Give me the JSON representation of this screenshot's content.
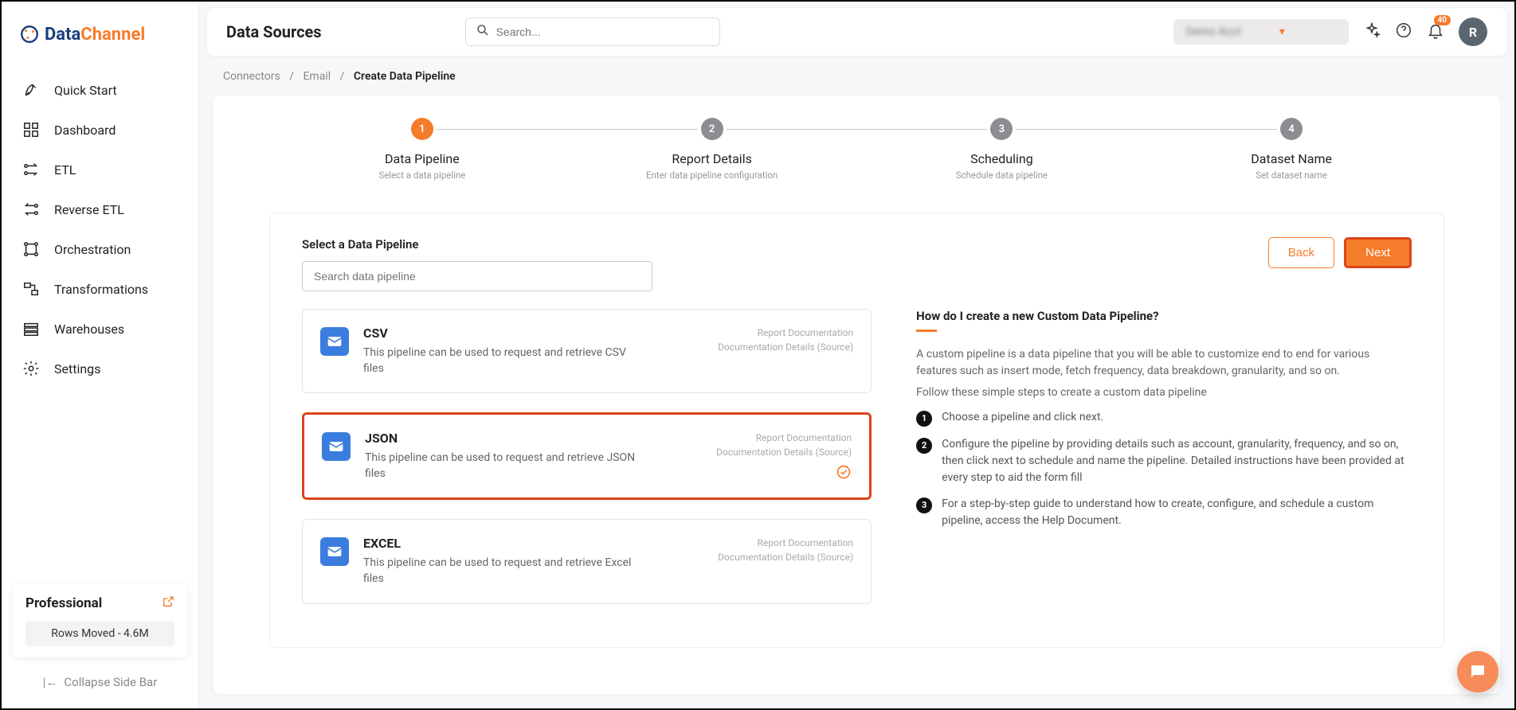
{
  "logo": {
    "text1": "Data",
    "text2": "Channel"
  },
  "sidebar": {
    "items": [
      {
        "label": "Quick Start"
      },
      {
        "label": "Dashboard"
      },
      {
        "label": "ETL"
      },
      {
        "label": "Reverse ETL"
      },
      {
        "label": "Orchestration"
      },
      {
        "label": "Transformations"
      },
      {
        "label": "Warehouses"
      },
      {
        "label": "Settings"
      }
    ],
    "plan": {
      "title": "Professional",
      "rows": "Rows Moved - 4.6M"
    },
    "collapse": "Collapse Side Bar"
  },
  "topbar": {
    "title": "Data Sources",
    "search_placeholder": "Search...",
    "account_label": "Demo Acct",
    "notif_count": "40",
    "avatar_letter": "R"
  },
  "breadcrumb": {
    "a": "Connectors",
    "b": "Email",
    "c": "Create Data Pipeline"
  },
  "stepper": [
    {
      "num": "1",
      "title": "Data Pipeline",
      "sub": "Select a data pipeline"
    },
    {
      "num": "2",
      "title": "Report Details",
      "sub": "Enter data pipeline configuration"
    },
    {
      "num": "3",
      "title": "Scheduling",
      "sub": "Schedule data pipeline"
    },
    {
      "num": "4",
      "title": "Dataset Name",
      "sub": "Set dataset name"
    }
  ],
  "inner": {
    "label": "Select a Data Pipeline",
    "search_placeholder": "Search data pipeline",
    "back": "Back",
    "next": "Next"
  },
  "pipelines": [
    {
      "name": "CSV",
      "desc": "This pipeline can be used to request and retrieve CSV files",
      "doc1": "Report Documentation",
      "doc2": "Documentation Details (Source)"
    },
    {
      "name": "JSON",
      "desc": "This pipeline can be used to request and retrieve JSON files",
      "doc1": "Report Documentation",
      "doc2": "Documentation Details (Source)"
    },
    {
      "name": "EXCEL",
      "desc": "This pipeline can be used to request and retrieve Excel files",
      "doc1": "Report Documentation",
      "doc2": "Documentation Details (Source)"
    }
  ],
  "help": {
    "title": "How do I create a new Custom Data Pipeline?",
    "intro1": "A custom pipeline is a data pipeline that you will be able to customize end to end for various features such as insert mode, fetch frequency, data breakdown, granularity, and so on.",
    "intro2": "Follow these simple steps to create a custom data pipeline",
    "steps": [
      "Choose a pipeline and click next.",
      "Configure the pipeline by providing details such as account, granularity, frequency, and so on, then click next to schedule and name the pipeline. Detailed instructions have been provided at every step to aid the form fill",
      "For a step-by-step guide to understand how to create, configure, and schedule a custom pipeline, access the Help Document."
    ]
  }
}
